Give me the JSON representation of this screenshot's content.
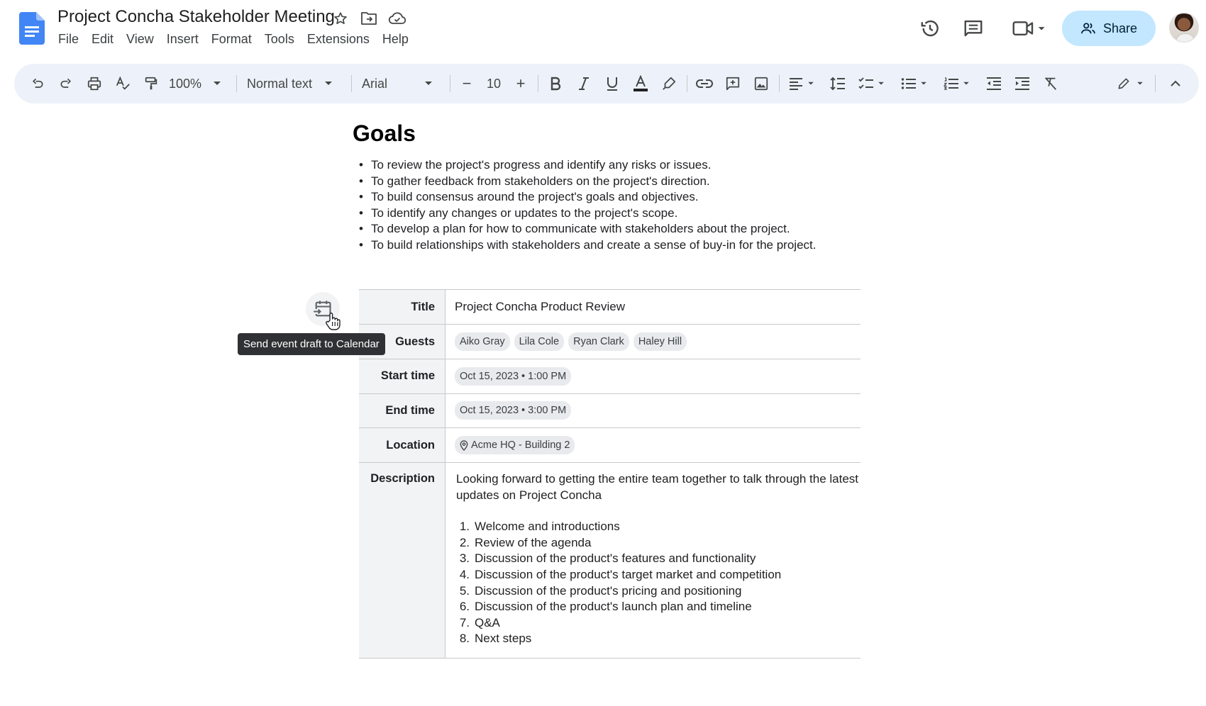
{
  "doc": {
    "title": "Project Concha Stakeholder Meeting"
  },
  "menu": [
    "File",
    "Edit",
    "View",
    "Insert",
    "Format",
    "Tools",
    "Extensions",
    "Help"
  ],
  "header": {
    "share_label": "Share"
  },
  "toolbar": {
    "zoom": "100%",
    "style": "Normal text",
    "font": "Arial",
    "font_size": "10",
    "minus": "−",
    "plus": "+"
  },
  "content": {
    "heading": "Goals",
    "goals": [
      "To review the project's progress and identify any risks or issues.",
      "To gather feedback from stakeholders on the project's direction.",
      "To build consensus around the project's goals and objectives.",
      "To identify any changes or updates to the project's scope.",
      "To develop a plan for how to communicate with stakeholders about the project.",
      "To build relationships with stakeholders and create a sense of buy-in for the project."
    ]
  },
  "event": {
    "labels": {
      "title": "Title",
      "guests": "Guests",
      "start": "Start time",
      "end": "End time",
      "location": "Location",
      "description": "Description"
    },
    "title": "Project Concha Product Review",
    "guests": [
      "Aiko Gray",
      "Lila Cole",
      "Ryan Clark",
      "Haley Hill"
    ],
    "start": "Oct 15, 2023 • 1:00 PM",
    "end": "Oct 15, 2023 • 3:00 PM",
    "location": "Acme HQ - Building 2",
    "description_intro": "Looking forward to getting the entire team together to talk through the latest updates on Project Concha",
    "agenda": [
      {
        "num": "1.",
        "text": "Welcome and introductions"
      },
      {
        "num": "2.",
        "text": "Review of the agenda"
      },
      {
        "num": "3.",
        "text": "Discussion of the product's features and functionality"
      },
      {
        "num": "4.",
        "text": "Discussion of the product's target market and competition"
      },
      {
        "num": "5.",
        "text": "Discussion of the product's pricing and positioning"
      },
      {
        "num": "6.",
        "text": "Discussion of the product's launch plan and timeline"
      },
      {
        "num": "7.",
        "text": "Q&A"
      },
      {
        "num": "8.",
        "text": "Next steps"
      }
    ]
  },
  "tooltip": {
    "text": "Send event draft to Calendar"
  },
  "colors": {
    "accent": "#1a73e8",
    "share_bg": "#c2e7ff",
    "toolbar_bg": "#edf2fa",
    "chip_bg": "#e8eaed"
  }
}
